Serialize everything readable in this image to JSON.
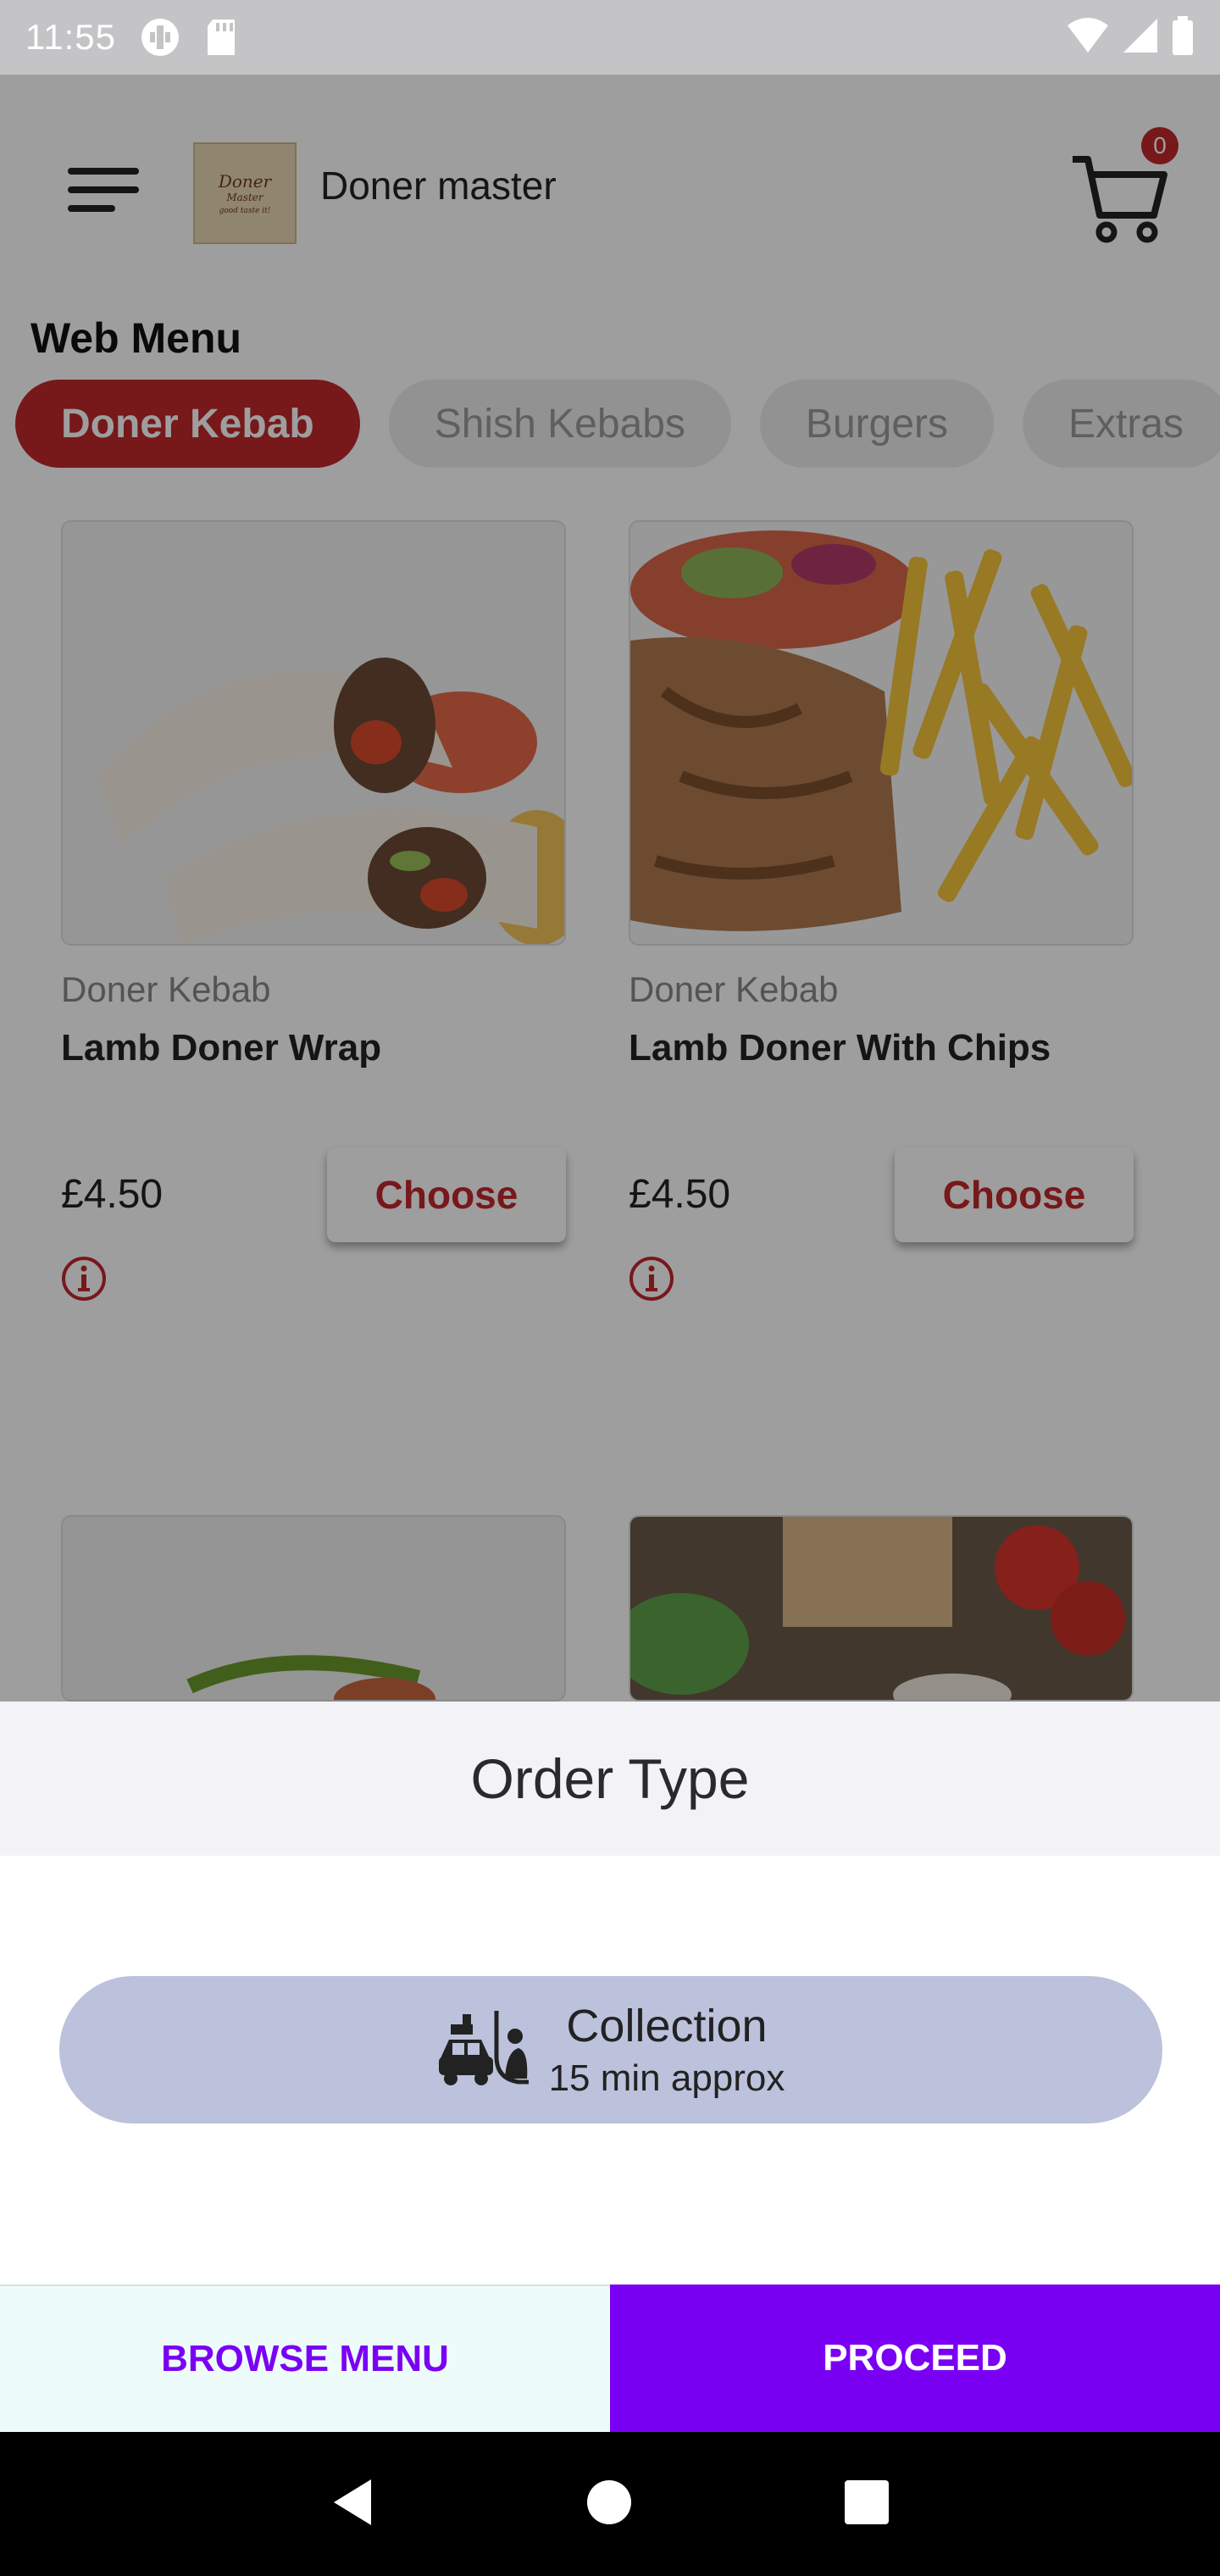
{
  "status_bar": {
    "time": "11:55",
    "icons": [
      "ring-icon",
      "sd-card-icon",
      "wifi-icon",
      "signal-icon",
      "battery-icon"
    ]
  },
  "header": {
    "app_name": "Doner master",
    "logo_text": {
      "line1": "Doner",
      "line2": "Master",
      "line3": "good taste it!"
    },
    "cart_count": "0"
  },
  "menu": {
    "title": "Web Menu",
    "categories": [
      {
        "label": "Doner Kebab",
        "active": true
      },
      {
        "label": "Shish Kebabs",
        "active": false
      },
      {
        "label": "Burgers",
        "active": false
      },
      {
        "label": "Extras",
        "active": false
      }
    ],
    "items": [
      {
        "category": "Doner Kebab",
        "name": "Lamb Doner Wrap",
        "price": "£4.50",
        "button": "Choose"
      },
      {
        "category": "Doner Kebab",
        "name": "Lamb Doner With Chips",
        "price": "£4.50",
        "button": "Choose"
      }
    ]
  },
  "sheet": {
    "title": "Order Type",
    "option": {
      "label": "Collection",
      "subtitle": "15 min approx",
      "icon": "collection-car-icon"
    }
  },
  "actions": {
    "browse": "BROWSE MENU",
    "proceed": "PROCEED"
  },
  "colors": {
    "brand_red": "#c0272d",
    "accent_purple": "#7a00f4",
    "option_bg": "#bcc2dc"
  }
}
